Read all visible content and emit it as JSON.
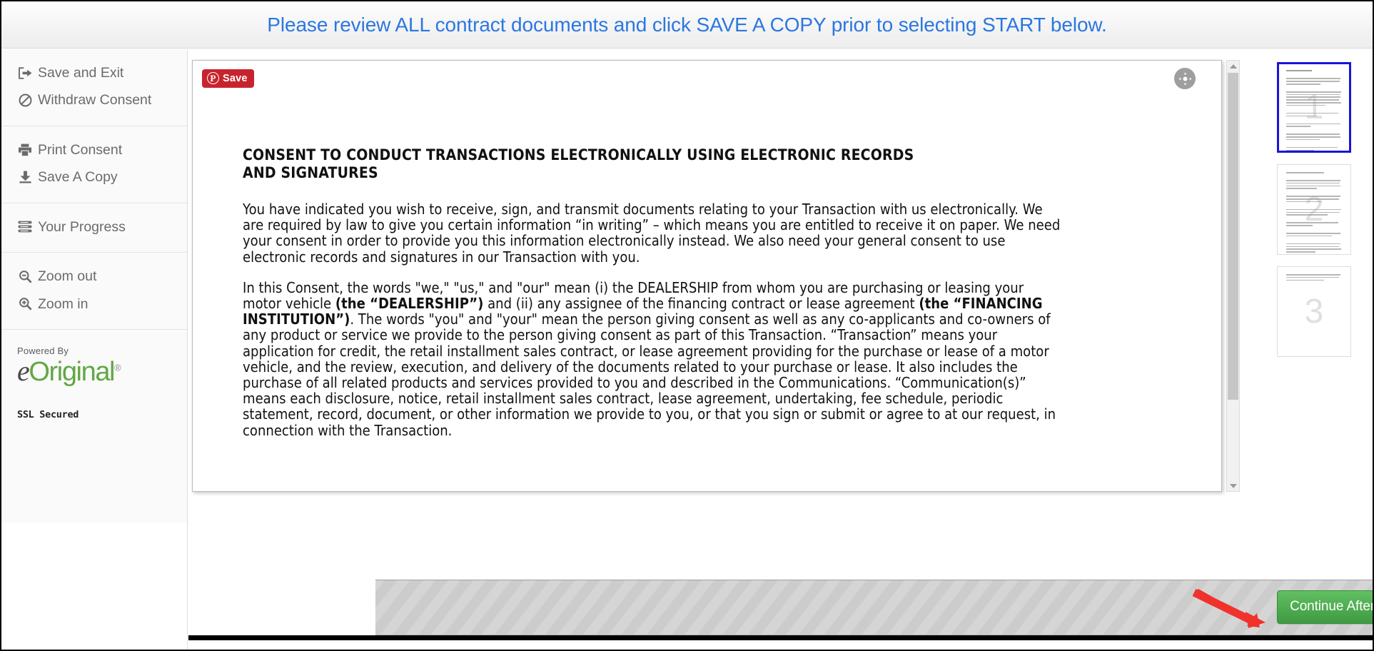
{
  "banner": {
    "message": "Please review ALL contract documents and click SAVE A COPY prior to selecting START below."
  },
  "colors": {
    "banner_text": "#2b77e0",
    "continue_button": "#4aa84d",
    "pinterest_red": "#c8232c",
    "thumb_selected_border": "#1a14d6",
    "logo_green": "#62a744",
    "arrow_red": "#f0322c"
  },
  "sidebar": {
    "groups": [
      {
        "items": [
          {
            "label": "Save and Exit",
            "icon": "sign-out-icon"
          },
          {
            "label": "Withdraw Consent",
            "icon": "ban-icon"
          }
        ]
      },
      {
        "items": [
          {
            "label": "Print Consent",
            "icon": "printer-icon"
          },
          {
            "label": "Save A Copy",
            "icon": "download-icon"
          }
        ]
      },
      {
        "items": [
          {
            "label": "Your Progress",
            "icon": "list-icon"
          }
        ]
      },
      {
        "items": [
          {
            "label": "Zoom out",
            "icon": "zoom-out-icon"
          },
          {
            "label": "Zoom in",
            "icon": "zoom-in-icon"
          }
        ]
      }
    ],
    "branding": {
      "powered_by": "Powered By",
      "logo_e": "e",
      "logo_rest": "Original",
      "logo_registered": "®",
      "ssl": "SSL Secured"
    }
  },
  "viewer": {
    "pinterest_save_label": "Save",
    "pinterest_glyph": "P",
    "pan_icon": "move-icon",
    "document": {
      "title": "CONSENT TO CONDUCT TRANSACTIONS ELECTRONICALLY USING ELECTRONIC RECORDS AND SIGNATURES",
      "paragraphs": [
        {
          "runs": [
            {
              "text": "You have indicated you wish to receive, sign, and transmit documents relating to your Transaction with us electronically.   We are required by law to give you certain information “in writing” – which means you are entitled to receive it on paper.  We need your consent in order to provide you this information electronically instead.  We also need your general consent to use electronic records and signatures in our Transaction with you.",
              "bold": false
            }
          ]
        },
        {
          "runs": [
            {
              "text": "In this Consent, the words \"we,\" \"us,\" and \"our\" mean (i) the DEALERSHIP from whom you are purchasing or leasing your motor vehicle ",
              "bold": false
            },
            {
              "text": "(the “DEALERSHIP”)",
              "bold": true
            },
            {
              "text": " and (ii) any assignee of the financing contract or lease agreement ",
              "bold": false
            },
            {
              "text": "(the “FINANCING INSTITUTION”)",
              "bold": true
            },
            {
              "text": ". The words \"you\" and \"your\" mean the person giving consent as well as any co-applicants and co-owners of any product or service we provide to the person giving consent as part of this Transaction.  “Transaction” means your application for credit, the retail installment sales contract, or lease agreement providing for the purchase or lease of a motor vehicle, and the review, execution, and delivery of the documents related to your purchase or lease.   It also includes the purchase of all related products and services provided to you and described in the Communications.  “Communication(s)” means each disclosure, notice, retail installment sales contract, lease agreement, undertaking, fee schedule, periodic statement, record, document, or other information we provide to you, or that you sign or submit or agree to at our request, in connection with the Transaction.",
              "bold": false
            }
          ]
        }
      ]
    },
    "scrollbar": {
      "up_arrow": "scroll-up-arrow",
      "down_arrow": "scroll-down-arrow"
    },
    "thumbnails": [
      {
        "page": "1",
        "selected": true
      },
      {
        "page": "2",
        "selected": false
      },
      {
        "page": "3",
        "selected": false
      }
    ]
  },
  "action_bar": {
    "continue_label": "Continue After Reviewing Document",
    "annotation_arrow": "red-pointer-arrow"
  }
}
